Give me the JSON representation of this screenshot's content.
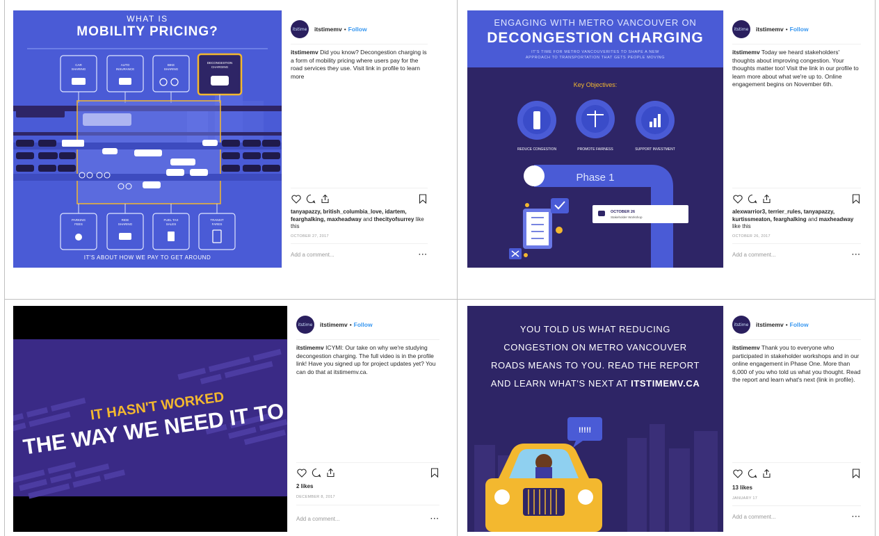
{
  "posts": [
    {
      "image": {
        "line1": "WHAT IS",
        "line2": "MOBILITY PRICING?",
        "boxes_top": [
          {
            "label": "CAR SHARING"
          },
          {
            "label": "AUTO INSURANCE"
          },
          {
            "label": "BIKE SHARING"
          },
          {
            "label": "DECONGESTION CHARGING",
            "highlight": true
          }
        ],
        "boxes_bottom": [
          {
            "label": "PARKING FEES"
          },
          {
            "label": "RIDE SHARING"
          },
          {
            "label": "FUEL TAX SALES"
          },
          {
            "label": "TRANSIT FARES"
          }
        ],
        "footer": "IT'S ABOUT HOW WE PAY TO GET AROUND"
      },
      "username": "itstimemv",
      "follow": "Follow",
      "caption": "Did you know? Decongestion charging is a form of mobility pricing where users pay for the road services they use. Visit link in profile to learn more",
      "liked_by": "tanyapazzy, british_columbia_love, idartem, fearghalking, maxheadway",
      "liked_and": "and",
      "liked_last": "thecityofsurrey",
      "liked_suffix": "like this",
      "date": "OCTOBER 27, 2017",
      "comment_placeholder": "Add a comment...",
      "more": "···"
    },
    {
      "image": {
        "line1": "ENGAGING WITH METRO VANCOUVER ON",
        "line2": "DECONGESTION CHARGING",
        "sub1": "IT'S TIME FOR METRO VANCOUVERITES TO SHAPE A NEW",
        "sub2": "APPROACH TO TRANSPORTATION THAT GETS PEOPLE MOVING",
        "objectives": "Key Objectives:",
        "obj1": "REDUCE CONGESTION",
        "obj2": "PROMOTE FAIRNESS",
        "obj3": "SUPPORT INVESTMENT",
        "phase": "Phase 1",
        "event_date": "OCTOBER 26",
        "event_name": "Stakeholder Workshop"
      },
      "username": "itstimemv",
      "follow": "Follow",
      "caption": "Today we heard stakeholders' thoughts about improving congestion. Your thoughts matter too! Visit the link in our profile to learn more about what we're up to. Online engagement begins on November 6th.",
      "liked_by": "alexwarrior3, terrier_rules, tanyapazzy, kurtissmeaton, fearghalking",
      "liked_and": "and",
      "liked_last": "maxheadway",
      "liked_suffix": "like this",
      "date": "OCTOBER 26, 2017",
      "comment_placeholder": "Add a comment...",
      "more": "···"
    },
    {
      "image": {
        "line1": "IT HASN'T WORKED",
        "line2": "THE WAY WE NEED IT TO"
      },
      "username": "itstimemv",
      "follow": "Follow",
      "caption": "ICYMI: Our take on why we're studying decongestion charging. The full video is in the profile link! Have you signed up for project updates yet? You can do that at itstimemv.ca.",
      "likes": "2 likes",
      "date": "DECEMBER 8, 2017",
      "comment_placeholder": "Add a comment...",
      "more": "···"
    },
    {
      "image": {
        "line1": "YOU TOLD US WHAT REDUCING",
        "line2": "CONGESTION ON METRO VANCOUVER",
        "line3": "ROADS MEANS TO YOU. READ THE REPORT",
        "line4a": "AND LEARN WHAT'S NEXT AT",
        "line4b": "ITSTIMEMV.CA",
        "bubble": "!!!!!"
      },
      "username": "itstimemv",
      "follow": "Follow",
      "caption": "Thank you to everyone who participated in stakeholder workshops and in our online engagement in Phase One. More than 6,000 of you who told us what you thought. Read the report and learn what's next (link in profile).",
      "likes": "13 likes",
      "date": "JANUARY 17",
      "comment_placeholder": "Add a comment...",
      "more": "···"
    }
  ],
  "avatar_text": "itstime",
  "colors": {
    "blue": "#4a5bd6",
    "navy": "#2e2566",
    "purple": "#3a2a86",
    "link": "#3897f0",
    "yellow": "#f3b82f"
  }
}
